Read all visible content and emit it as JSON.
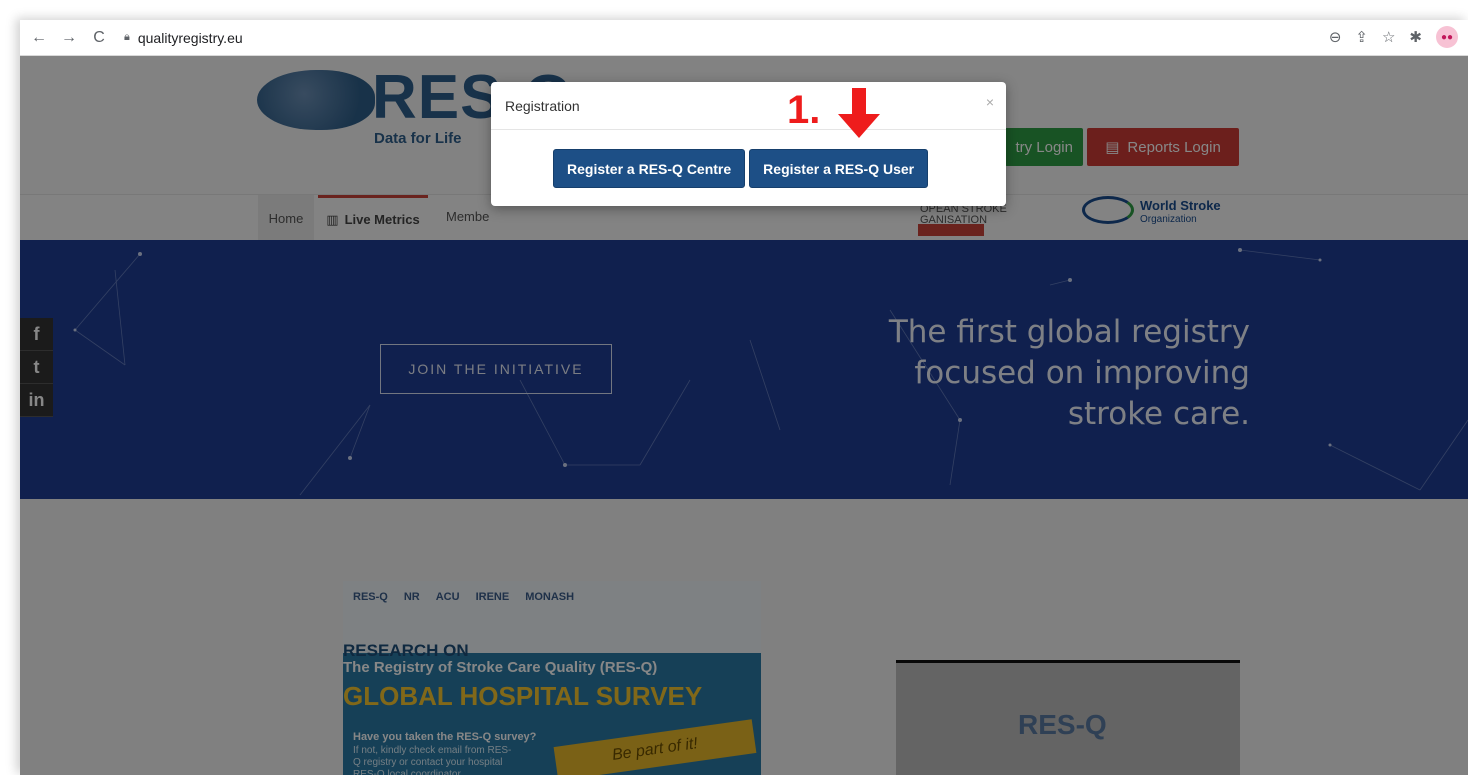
{
  "browser": {
    "url": "qualityregistry.eu",
    "back_icon": "←",
    "forward_icon": "→",
    "reload_icon": "C"
  },
  "site": {
    "logo_text": "RES-Q",
    "logo_tagline": "Data for Life",
    "registry_login": "try Login",
    "reports_login": "Reports Login",
    "nav": {
      "home": "Home",
      "live_metrics": "Live Metrics",
      "members": "Membe"
    },
    "partners": {
      "eso_line1": "OPEAN STROKE",
      "eso_line2": "GANISATION",
      "wso_name": "World Stroke",
      "wso_sub": "Organization"
    }
  },
  "hero": {
    "join_button": "JOIN THE INITIATIVE",
    "tagline_line1": "The first global registry",
    "tagline_line2": "focused on improving",
    "tagline_line3": "stroke care."
  },
  "social": {
    "facebook": "f",
    "twitter": "t",
    "linkedin": "in"
  },
  "poster": {
    "logos": [
      "RES-Q",
      "NR",
      "ACU",
      "IRENE",
      "MONASH"
    ],
    "heading": "RESEARCH ON",
    "subheading": "The Registry of Stroke Care Quality (RES-Q)",
    "title": "GLOBAL HOSPITAL SURVEY",
    "question": "Have you taken the RES-Q survey?",
    "body": "If not, kindly check email from RES-Q registry or contact your hospital RES-Q local coordinator",
    "brush": "Be part of it!"
  },
  "video": {
    "logo": "RES-Q"
  },
  "modal": {
    "title": "Registration",
    "close": "×",
    "register_centre": "Register a RES-Q Centre",
    "register_user": "Register a RES-Q User"
  },
  "annotation": {
    "label": "1.",
    "color": "#ee1c1c"
  }
}
